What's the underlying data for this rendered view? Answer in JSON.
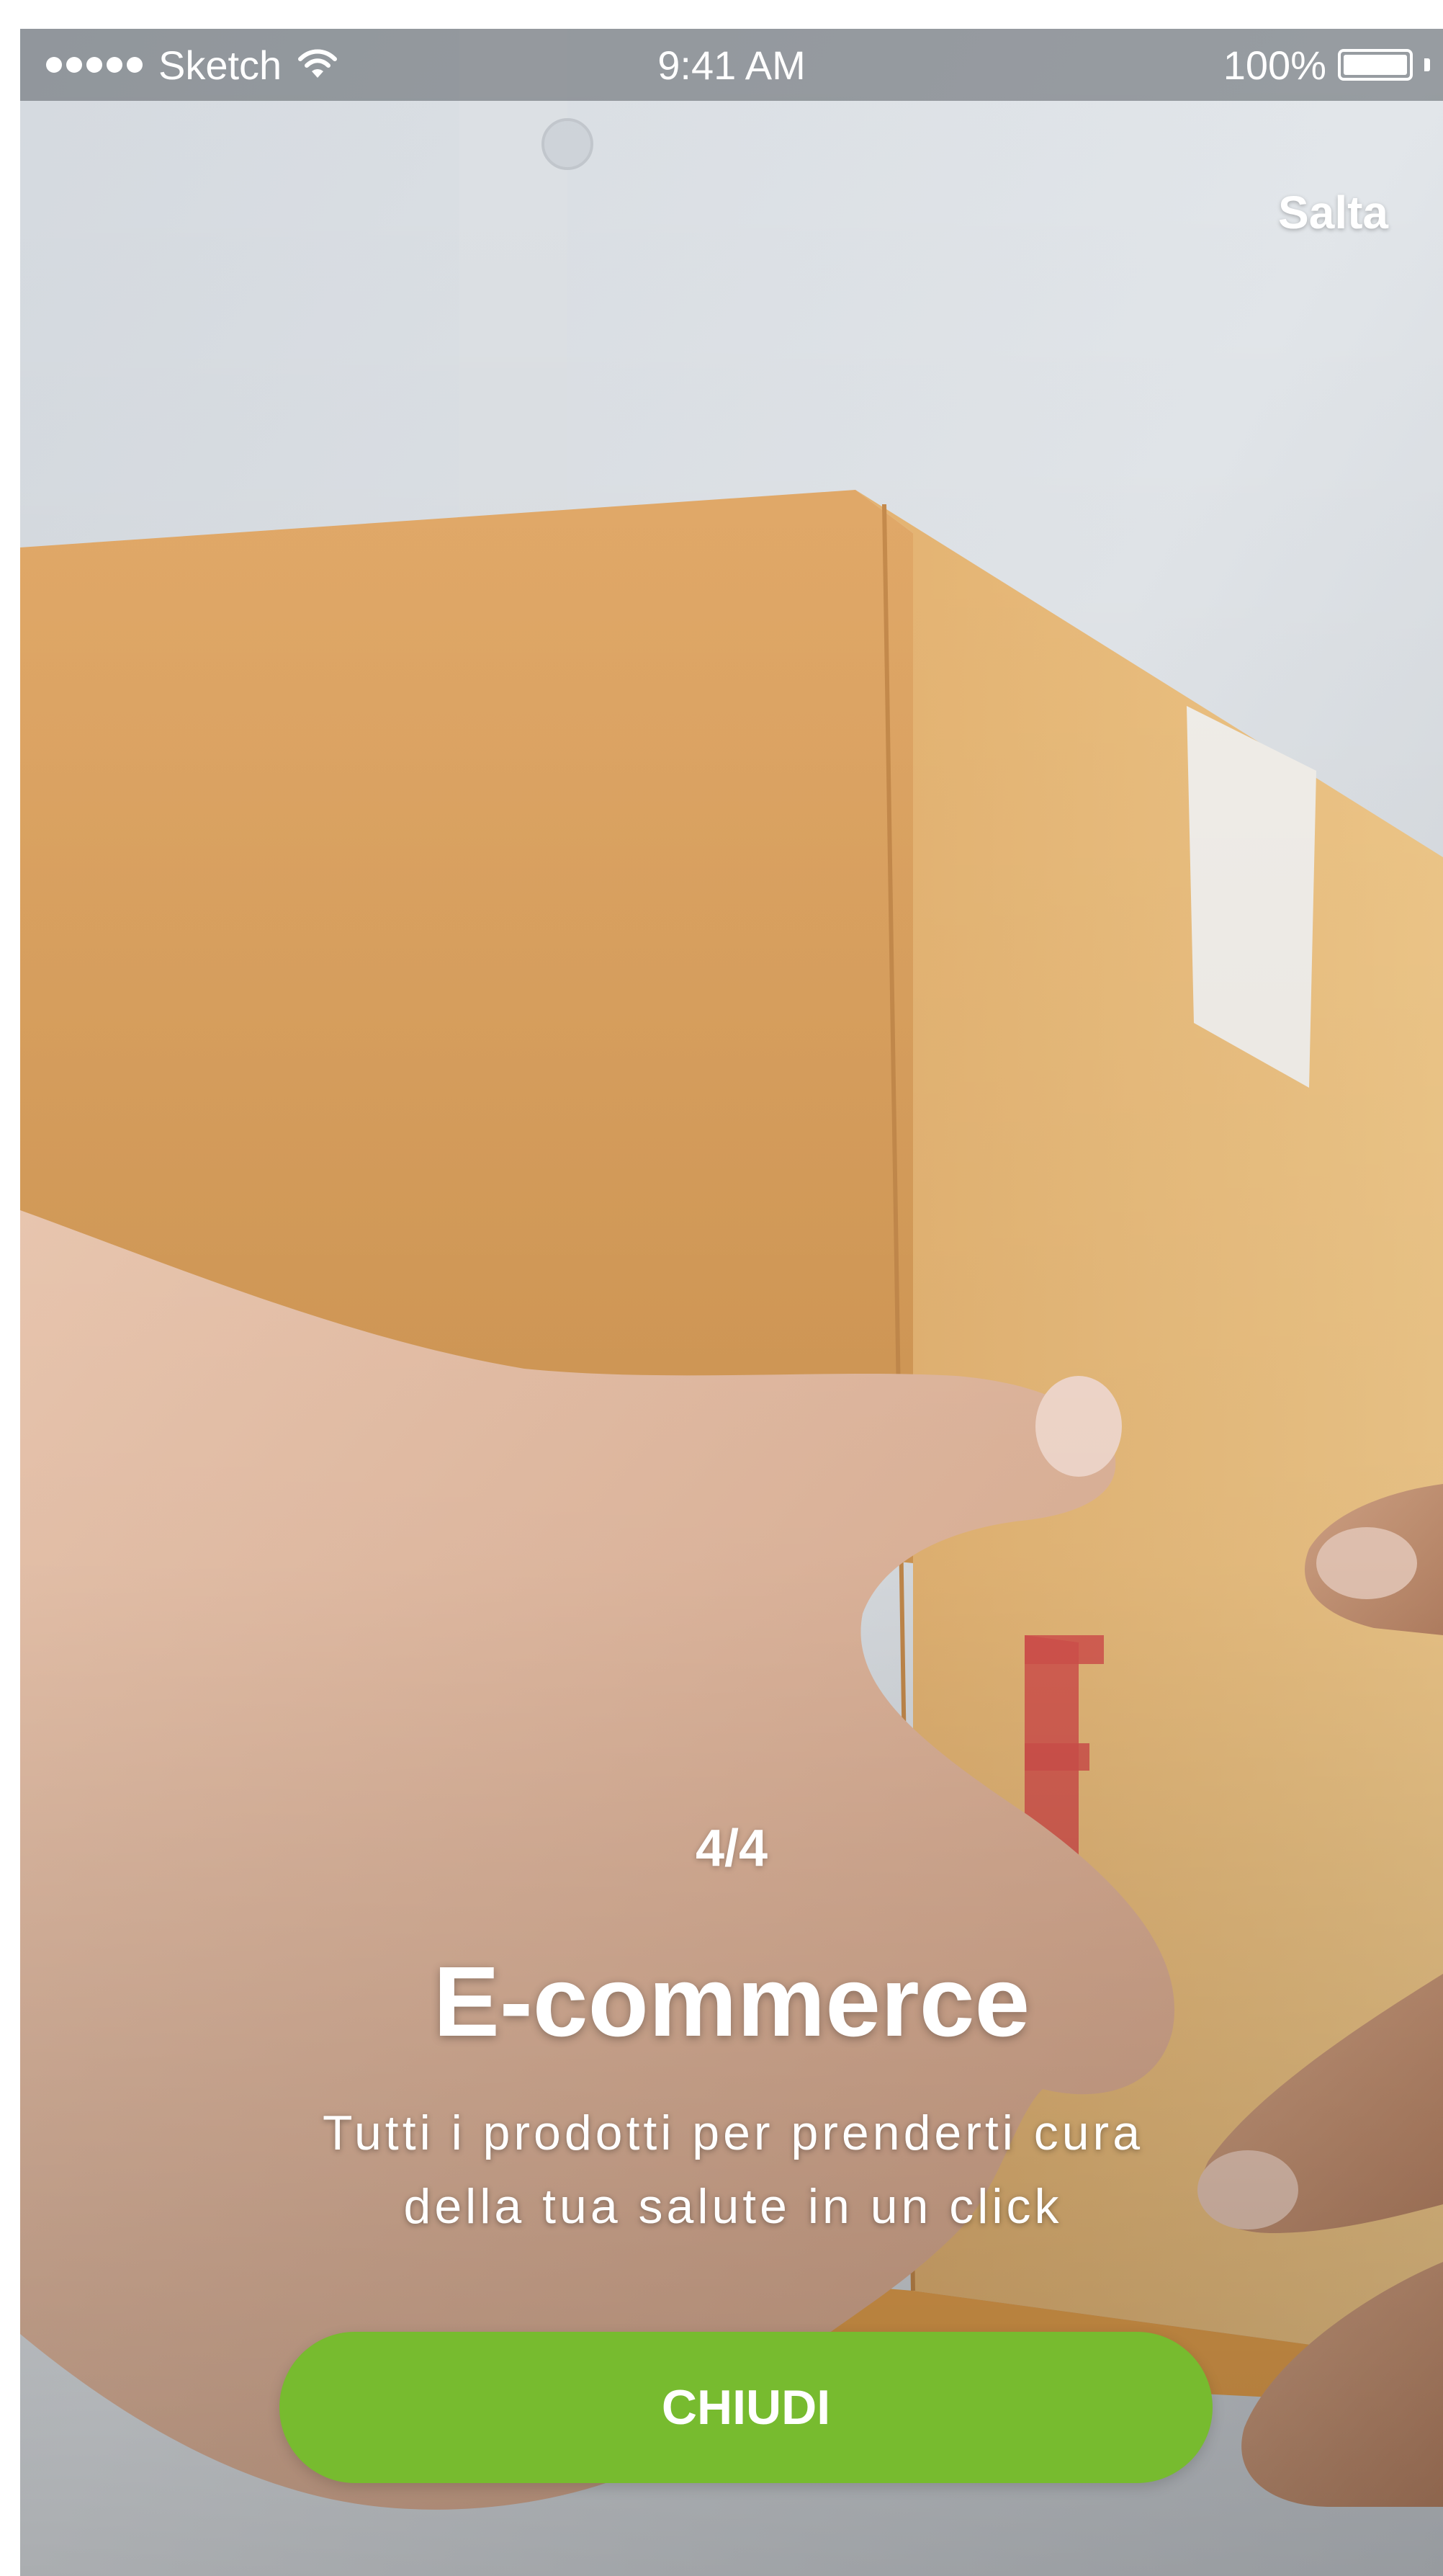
{
  "status_bar": {
    "carrier": "Sketch",
    "time": "9:41 AM",
    "battery_percent": "100%",
    "icons": [
      "signal-dots-icon",
      "wifi-icon",
      "battery-icon"
    ]
  },
  "header": {
    "skip_label": "Salta"
  },
  "onboarding": {
    "page_indicator": "4/4",
    "title": "E-commerce",
    "description_line1": "Tutti i prodotti per prenderti cura",
    "description_line2": "della tua salute in un click"
  },
  "cta": {
    "label": "CHIUDI"
  },
  "colors": {
    "accent_green": "#77bb2f",
    "status_bar_overlay": "rgba(90,95,100,0.55)",
    "text_on_image": "#ffffff"
  }
}
